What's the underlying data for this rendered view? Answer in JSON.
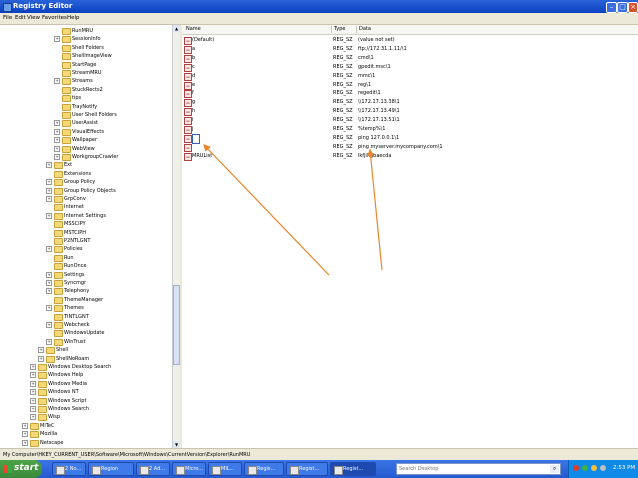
{
  "window": {
    "title": "Registry Editor"
  },
  "menu": [
    "File",
    "Edit",
    "View",
    "Favorites",
    "Help"
  ],
  "tree": [
    {
      "label": "RunMRU",
      "depth": 4,
      "expander": ""
    },
    {
      "label": "SessionInfo",
      "depth": 4,
      "expander": "+"
    },
    {
      "label": "Shell Folders",
      "depth": 4,
      "expander": ""
    },
    {
      "label": "ShellImageView",
      "depth": 4,
      "expander": ""
    },
    {
      "label": "StartPage",
      "depth": 4,
      "expander": ""
    },
    {
      "label": "StreamMRU",
      "depth": 4,
      "expander": ""
    },
    {
      "label": "Streams",
      "depth": 4,
      "expander": "+"
    },
    {
      "label": "StuckRects2",
      "depth": 4,
      "expander": ""
    },
    {
      "label": "tips",
      "depth": 4,
      "expander": ""
    },
    {
      "label": "TrayNotify",
      "depth": 4,
      "expander": ""
    },
    {
      "label": "User Shell Folders",
      "depth": 4,
      "expander": ""
    },
    {
      "label": "UserAssist",
      "depth": 4,
      "expander": "+"
    },
    {
      "label": "VisualEffects",
      "depth": 4,
      "expander": "+"
    },
    {
      "label": "Wallpaper",
      "depth": 4,
      "expander": "+"
    },
    {
      "label": "WebView",
      "depth": 4,
      "expander": "+"
    },
    {
      "label": "WorkgroupCrawler",
      "depth": 4,
      "expander": "+"
    },
    {
      "label": "Ext",
      "depth": 3,
      "expander": "+"
    },
    {
      "label": "Extensions",
      "depth": 3,
      "expander": ""
    },
    {
      "label": "Group Policy",
      "depth": 3,
      "expander": "+"
    },
    {
      "label": "Group Policy Objects",
      "depth": 3,
      "expander": "+"
    },
    {
      "label": "GrpConv",
      "depth": 3,
      "expander": "+"
    },
    {
      "label": "Internet",
      "depth": 3,
      "expander": ""
    },
    {
      "label": "Internet Settings",
      "depth": 3,
      "expander": "+"
    },
    {
      "label": "MSSCIPY",
      "depth": 3,
      "expander": ""
    },
    {
      "label": "MSTCIPH",
      "depth": 3,
      "expander": ""
    },
    {
      "label": "P2NTLGNT",
      "depth": 3,
      "expander": ""
    },
    {
      "label": "Policies",
      "depth": 3,
      "expander": "+"
    },
    {
      "label": "Run",
      "depth": 3,
      "expander": ""
    },
    {
      "label": "RunOnce",
      "depth": 3,
      "expander": ""
    },
    {
      "label": "Settings",
      "depth": 3,
      "expander": "+"
    },
    {
      "label": "Syncmgr",
      "depth": 3,
      "expander": "+"
    },
    {
      "label": "Telephony",
      "depth": 3,
      "expander": "+"
    },
    {
      "label": "ThemeManager",
      "depth": 3,
      "expander": ""
    },
    {
      "label": "Themes",
      "depth": 3,
      "expander": "+"
    },
    {
      "label": "TINTLGNT",
      "depth": 3,
      "expander": ""
    },
    {
      "label": "Webcheck",
      "depth": 3,
      "expander": "+"
    },
    {
      "label": "WindowsUpdate",
      "depth": 3,
      "expander": ""
    },
    {
      "label": "WinTrust",
      "depth": 3,
      "expander": "+"
    },
    {
      "label": "Shell",
      "depth": 2,
      "expander": "+"
    },
    {
      "label": "ShellNoRoam",
      "depth": 2,
      "expander": "+"
    },
    {
      "label": "Windows Desktop Search",
      "depth": 1,
      "expander": "+"
    },
    {
      "label": "Windows Help",
      "depth": 1,
      "expander": "+"
    },
    {
      "label": "Windows Media",
      "depth": 1,
      "expander": "+"
    },
    {
      "label": "Windows NT",
      "depth": 1,
      "expander": "+"
    },
    {
      "label": "Windows Script",
      "depth": 1,
      "expander": "+"
    },
    {
      "label": "Windows Search",
      "depth": 1,
      "expander": "+"
    },
    {
      "label": "Wisp",
      "depth": 1,
      "expander": "+"
    },
    {
      "label": "MiTeC",
      "depth": 0,
      "expander": "+"
    },
    {
      "label": "Mozilla",
      "depth": 0,
      "expander": "+"
    },
    {
      "label": "Netscape",
      "depth": 0,
      "expander": "+"
    }
  ],
  "columns": {
    "name": "Name",
    "type": "Type",
    "data": "Data"
  },
  "values": [
    {
      "name": "(Default)",
      "type": "REG_SZ",
      "data": "(value not set)"
    },
    {
      "name": "a",
      "type": "REG_SZ",
      "data": "ftp://172.31.1.11/\\1"
    },
    {
      "name": "b",
      "type": "REG_SZ",
      "data": "cmd\\1"
    },
    {
      "name": "c",
      "type": "REG_SZ",
      "data": "gpedit.msc\\1"
    },
    {
      "name": "d",
      "type": "REG_SZ",
      "data": "mmc\\1"
    },
    {
      "name": "e",
      "type": "REG_SZ",
      "data": "reg\\1"
    },
    {
      "name": "f",
      "type": "REG_SZ",
      "data": "regedit\\1"
    },
    {
      "name": "g",
      "type": "REG_SZ",
      "data": "\\\\172.17.13.38\\1"
    },
    {
      "name": "h",
      "type": "REG_SZ",
      "data": "\\\\172.17.13.49\\1"
    },
    {
      "name": "i",
      "type": "REG_SZ",
      "data": "\\\\172.17.13.51\\1"
    },
    {
      "name": "j",
      "type": "REG_SZ",
      "data": "%temp%\\1"
    },
    {
      "name": "",
      "type": "REG_SZ",
      "data": "ping 127.0.0.1\\1",
      "editing": true
    },
    {
      "name": "",
      "type": "REG_SZ",
      "data": "ping myserver.mycompany.com\\1"
    },
    {
      "name": "MRUList",
      "type": "REG_SZ",
      "data": "lkfjihgbaecda"
    }
  ],
  "status": "My Computer\\HKEY_CURRENT_USER\\Software\\Microsoft\\Windows\\CurrentVersion\\Explorer\\RunMRU",
  "taskbar": {
    "start": "start",
    "buttons": [
      "2 No...",
      "Region",
      "2 Ad...",
      "Micro...",
      "MIL...",
      "Regis...",
      "Regist...",
      "Regist..."
    ],
    "search_placeholder": "Search Desktop",
    "clock": "2:53 PM"
  },
  "colors": {
    "annotation_arrow": "#e8852a",
    "title_bar": "#0a3fc0",
    "start_button": "#3a8a3a"
  }
}
